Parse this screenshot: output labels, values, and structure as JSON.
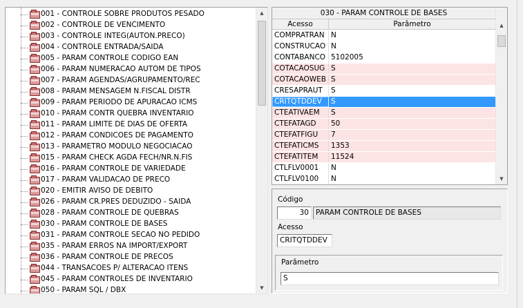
{
  "tree": {
    "items": [
      "001 - CONTROLE SOBRE PRODUTOS PESADO",
      "002 - CONTROLE DE VENCIMENTO",
      "003 - CONTROLE INTEG(AUTON.PRECO)",
      "004 - CONTROLE ENTRADA/SAIDA",
      "005 - PARAM CONTROLE CODIGO EAN",
      "006 - PARAM NUMERACAO AUTOM DE TIPOS",
      "007 - PARAM AGENDAS/AGRUPAMENTO/REC",
      "008 - PARAM MENSAGEM N.FISCAL DISTR",
      "009 - PARAM PERIODO DE APURACAO ICMS",
      "010 - PARAM CONTR QUEBRA INVENTARIO",
      "011 - PARAM LIMITE DE DIAS DE OFERTA",
      "012 - PARAM CONDICOES DE PAGAMENTO",
      "013 - PARAMETRO MODULO NEGOCIACAO",
      "015 - PARAM CHECK AGDA FECH/NR.N.FIS",
      "016 - PARAM CONTROLE DE VARIEDADE",
      "017 - PARAM VALIDACAO DE PRECO",
      "020 - EMITIR AVISO DE DEBITO",
      "026 - PARAM CR.PRES DEDUZIDO - SAIDA",
      "028 - PARAM CONTROLE DE QUEBRAS",
      "030 - PARAM CONTROLE DE BASES",
      "031 - PARAM CONTROLE SECAO NO PEDIDO",
      "035 - PARAM ERROS NA IMPORT/EXPORT",
      "036 - PARAM CONTROLE DE PRECOS",
      "044 - TRANSACOES P/ ALTERACAO ITENS",
      "045 - PARAM CONTROLES DE INVENTARIO",
      "050 - PARAM SQL / DBX"
    ],
    "icon": "folder-icon"
  },
  "grid": {
    "title": "030 - PARAM CONTROLE DE BASES",
    "col_access": "Acesso",
    "col_param": "Parâmetro",
    "rows": [
      {
        "acesso": "COMPRATRAN",
        "param": "N",
        "style": "white"
      },
      {
        "acesso": "CONSTRUCAO",
        "param": "N",
        "style": "white"
      },
      {
        "acesso": "CONTABANCO",
        "param": "5102005",
        "style": "white"
      },
      {
        "acesso": "COTACAOSUG",
        "param": "S",
        "style": "pink"
      },
      {
        "acesso": "COTACAOWEB",
        "param": "S",
        "style": "pink"
      },
      {
        "acesso": "CRESAPRAUT",
        "param": "S",
        "style": "white"
      },
      {
        "acesso": "CRITQTDDEV",
        "param": "S",
        "style": "selected"
      },
      {
        "acesso": "CTEATIVAEM",
        "param": "S",
        "style": "pink"
      },
      {
        "acesso": "CTEFATAGD",
        "param": "50",
        "style": "pink"
      },
      {
        "acesso": "CTEFATFIGU",
        "param": "7",
        "style": "pink"
      },
      {
        "acesso": "CTEFATICMS",
        "param": "1353",
        "style": "pink"
      },
      {
        "acesso": "CTEFATITEM",
        "param": "11524",
        "style": "pink"
      },
      {
        "acesso": "CTLFLV0001",
        "param": "N",
        "style": "white"
      },
      {
        "acesso": "CTLFLV0100",
        "param": "N",
        "style": "white"
      }
    ]
  },
  "detail": {
    "codigo_label": "Código",
    "codigo_value": "30",
    "codigo_desc": "PARAM CONTROLE DE BASES",
    "acesso_label": "Acesso",
    "acesso_value": "CRITQTDDEV",
    "parametro_label": "Parâmetro",
    "parametro_value": "S"
  },
  "colors": {
    "selected": "#3399ff",
    "pink_row": "#fde4e4",
    "folder": "#d99a9a"
  }
}
